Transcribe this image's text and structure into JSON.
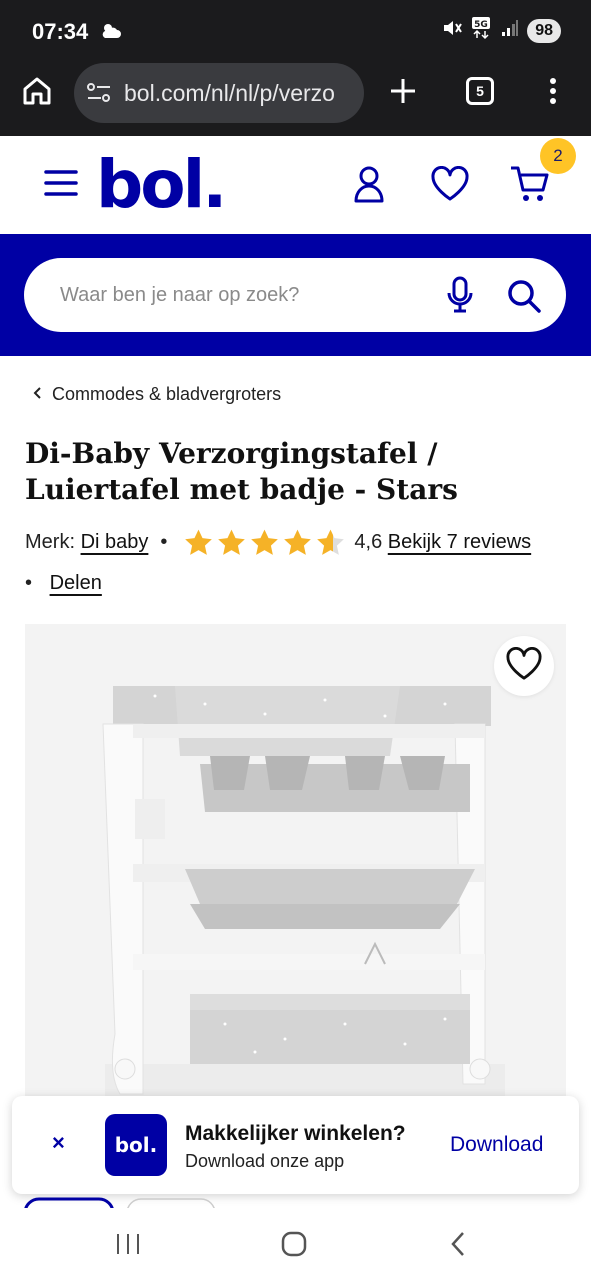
{
  "status_bar": {
    "time": "07:34",
    "battery": "98"
  },
  "browser": {
    "url": "bol.com/nl/nl/p/verzo",
    "tab_count": "5"
  },
  "header": {
    "logo": "bol.",
    "cart_count": "2"
  },
  "search": {
    "placeholder": "Waar ben je naar op zoek?"
  },
  "breadcrumb": {
    "label": "Commodes & bladvergroters"
  },
  "product": {
    "title": "Di-Baby Verzorgingstafel / Luiertafel met badje - Stars",
    "brand_label": "Merk:",
    "brand": "Di baby",
    "rating": "4,6",
    "rating_value": 4.6,
    "reviews_link": "Bekijk 7 reviews",
    "share": "Delen"
  },
  "app_banner": {
    "logo": "bol.",
    "title": "Makkelijker winkelen?",
    "subtitle": "Download onze app",
    "download": "Download",
    "close": "×"
  },
  "colors": {
    "brand_blue": "#0000a4",
    "badge_yellow": "#ffc426",
    "star": "#f5b227"
  }
}
